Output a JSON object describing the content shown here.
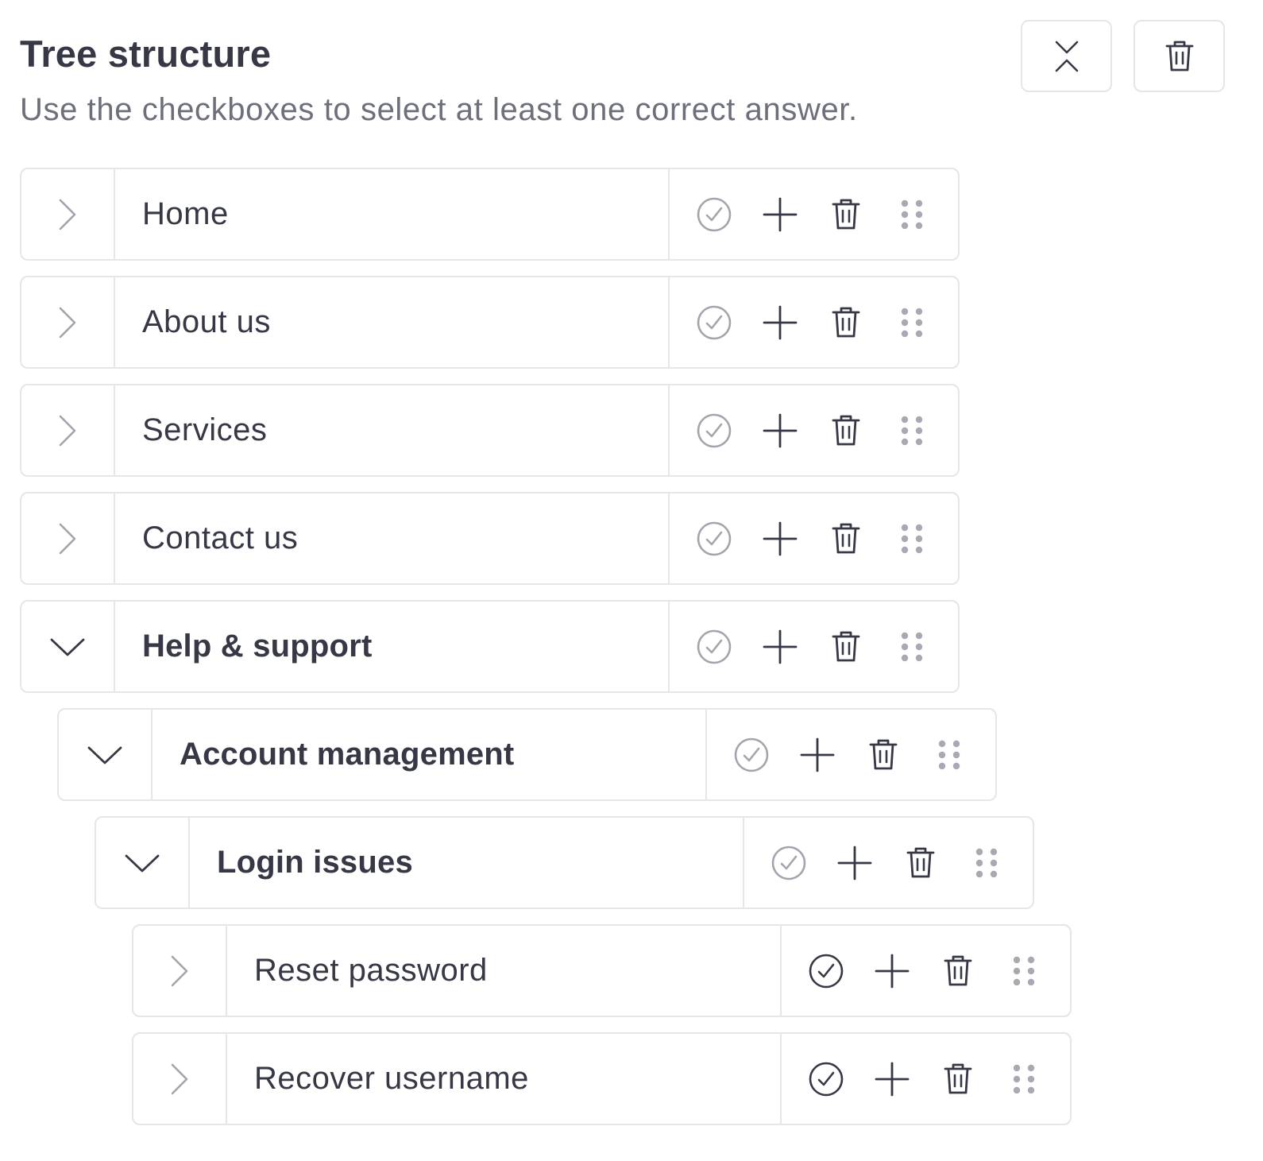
{
  "header": {
    "title": "Tree structure",
    "subtitle": "Use the checkboxes to select at least one correct answer."
  },
  "toolbar": {
    "collapse_icon": "collapse-all-icon",
    "delete_icon": "trash-icon"
  },
  "tree": {
    "items": [
      {
        "label": "Home",
        "level": 0,
        "expanded": false,
        "correct": false,
        "bold": false
      },
      {
        "label": "About us",
        "level": 0,
        "expanded": false,
        "correct": false,
        "bold": false
      },
      {
        "label": "Services",
        "level": 0,
        "expanded": false,
        "correct": false,
        "bold": false
      },
      {
        "label": "Contact us",
        "level": 0,
        "expanded": false,
        "correct": false,
        "bold": false
      },
      {
        "label": "Help & support",
        "level": 0,
        "expanded": true,
        "correct": false,
        "bold": true
      },
      {
        "label": "Account management",
        "level": 1,
        "expanded": true,
        "correct": false,
        "bold": true
      },
      {
        "label": "Login issues",
        "level": 2,
        "expanded": true,
        "correct": false,
        "bold": true
      },
      {
        "label": "Reset password",
        "level": 3,
        "expanded": false,
        "correct": true,
        "bold": false
      },
      {
        "label": "Recover username",
        "level": 3,
        "expanded": false,
        "correct": true,
        "bold": false
      }
    ]
  },
  "colors": {
    "text": "#363846",
    "muted_text": "#6d6f7b",
    "border": "#e6e6ea",
    "icon_dark": "#363846",
    "icon_muted": "#a3a4ad",
    "drag_dots": "#a8a9b3"
  }
}
